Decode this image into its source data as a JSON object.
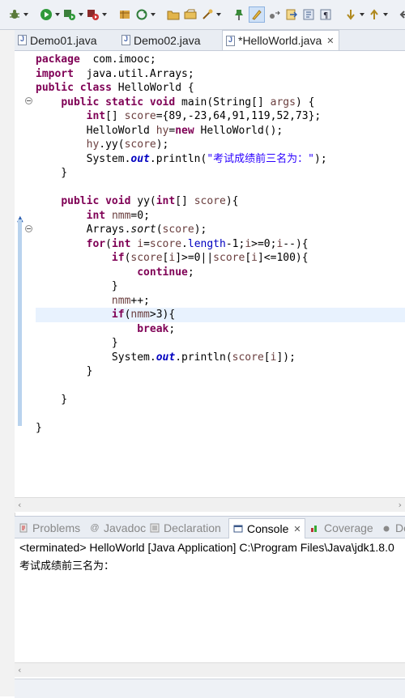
{
  "toolbar": {
    "icons": [
      "debug-icon",
      "run-icon",
      "run-config-icon",
      "external-tools-icon",
      "new-java-project-icon",
      "refresh-icon",
      "open-folder-icon",
      "open-task-icon",
      "open-resource-icon",
      "pin-icon",
      "highlight-icon",
      "forward-icon",
      "toggle-comment-icon",
      "show-whitespace-icon",
      "next-annotation-icon",
      "previous-annotation-icon"
    ]
  },
  "editor": {
    "tabs": [
      {
        "label": "Demo01.java",
        "active": false
      },
      {
        "label": "Demo02.java",
        "active": false
      },
      {
        "label": "*HelloWorld.java",
        "active": true
      }
    ],
    "close_glyph": "✕"
  },
  "code_lines": [
    [
      [
        "kw",
        "package"
      ],
      [
        "",
        "  com.imooc;"
      ]
    ],
    [
      [
        "kw",
        "import"
      ],
      [
        "",
        "  java.util.Arrays;"
      ]
    ],
    [
      [
        "kw",
        "public"
      ],
      [
        "",
        " "
      ],
      [
        "kw",
        "class"
      ],
      [
        "",
        " HelloWorld {"
      ]
    ],
    [
      [
        "",
        "    "
      ],
      [
        "kw",
        "public"
      ],
      [
        "",
        " "
      ],
      [
        "kw",
        "static"
      ],
      [
        "",
        " "
      ],
      [
        "kw",
        "void"
      ],
      [
        "",
        " main(String[] "
      ],
      [
        "var",
        "args"
      ],
      [
        "",
        ") {"
      ]
    ],
    [
      [
        "",
        "        "
      ],
      [
        "kw",
        "int"
      ],
      [
        "",
        "[] "
      ],
      [
        "var",
        "score"
      ],
      [
        "",
        "={89,-23,64,91,119,52,73};"
      ]
    ],
    [
      [
        "",
        "        HelloWorld "
      ],
      [
        "var",
        "hy"
      ],
      [
        "",
        "="
      ],
      [
        "kw",
        "new"
      ],
      [
        "",
        " HelloWorld();"
      ]
    ],
    [
      [
        "",
        "        "
      ],
      [
        "var",
        "hy"
      ],
      [
        "",
        ".yy("
      ],
      [
        "var",
        "score"
      ],
      [
        "",
        ");"
      ]
    ],
    [
      [
        "",
        "        System."
      ],
      [
        "fld",
        "out"
      ],
      [
        "",
        ".println("
      ],
      [
        "str",
        "\"考试成绩前三名为：\""
      ],
      [
        "",
        ");"
      ]
    ],
    [
      [
        "",
        "    }"
      ]
    ],
    [
      [
        "",
        ""
      ]
    ],
    [
      [
        "",
        "    "
      ],
      [
        "kw",
        "public"
      ],
      [
        "",
        " "
      ],
      [
        "kw",
        "void"
      ],
      [
        "",
        " yy("
      ],
      [
        "kw",
        "int"
      ],
      [
        "",
        "[] "
      ],
      [
        "var",
        "score"
      ],
      [
        "",
        "){"
      ]
    ],
    [
      [
        "",
        "        "
      ],
      [
        "kw",
        "int"
      ],
      [
        "",
        " "
      ],
      [
        "var",
        "nmm"
      ],
      [
        "",
        "=0;"
      ]
    ],
    [
      [
        "",
        "        Arrays."
      ],
      [
        "ital",
        "sort"
      ],
      [
        "",
        "("
      ],
      [
        "var",
        "score"
      ],
      [
        "",
        ");"
      ]
    ],
    [
      [
        "",
        "        "
      ],
      [
        "kw",
        "for"
      ],
      [
        "",
        "("
      ],
      [
        "kw",
        "int"
      ],
      [
        "",
        " "
      ],
      [
        "var",
        "i"
      ],
      [
        "",
        "="
      ],
      [
        "var",
        "score"
      ],
      [
        "",
        "."
      ],
      [
        "fldn",
        "length"
      ],
      [
        "",
        "-1;"
      ],
      [
        "var",
        "i"
      ],
      [
        "",
        ">=0;"
      ],
      [
        "var",
        "i"
      ],
      [
        "",
        "--){"
      ]
    ],
    [
      [
        "",
        "            "
      ],
      [
        "kw",
        "if"
      ],
      [
        "",
        "("
      ],
      [
        "var",
        "score"
      ],
      [
        "",
        "["
      ],
      [
        "var",
        "i"
      ],
      [
        "",
        "]>=0||"
      ],
      [
        "var",
        "score"
      ],
      [
        "",
        "["
      ],
      [
        "var",
        "i"
      ],
      [
        "",
        "]<=100){"
      ]
    ],
    [
      [
        "",
        "                "
      ],
      [
        "kw",
        "continue"
      ],
      [
        "",
        ";"
      ]
    ],
    [
      [
        "",
        "            }"
      ]
    ],
    [
      [
        "",
        "            "
      ],
      [
        "var",
        "nmm"
      ],
      [
        "",
        "++;"
      ]
    ],
    [
      [
        "",
        "            "
      ],
      [
        "kw",
        "if"
      ],
      [
        "",
        "("
      ],
      [
        "var",
        "nmm"
      ],
      [
        "",
        ">3){"
      ]
    ],
    [
      [
        "",
        "                "
      ],
      [
        "kw",
        "break"
      ],
      [
        "",
        ";"
      ]
    ],
    [
      [
        "",
        "            }"
      ]
    ],
    [
      [
        "",
        "            System."
      ],
      [
        "fld",
        "out"
      ],
      [
        "",
        ".println("
      ],
      [
        "var",
        "score"
      ],
      [
        "",
        "["
      ],
      [
        "var",
        "i"
      ],
      [
        "",
        "]);"
      ]
    ],
    [
      [
        "",
        "        }"
      ]
    ],
    [
      [
        "",
        ""
      ]
    ],
    [
      [
        "",
        "    }"
      ]
    ],
    [
      [
        "",
        ""
      ]
    ],
    [
      [
        "",
        "}"
      ]
    ]
  ],
  "views": {
    "tabs": [
      {
        "label": "Problems",
        "icon": "problems-icon",
        "active": false
      },
      {
        "label": "Javadoc",
        "icon": "javadoc-icon",
        "active": false
      },
      {
        "label": "Declaration",
        "icon": "declaration-icon",
        "active": false
      },
      {
        "label": "Console",
        "icon": "console-icon",
        "active": true
      },
      {
        "label": "Coverage",
        "icon": "coverage-icon",
        "active": false
      },
      {
        "label": "De",
        "icon": "debug-view-icon",
        "active": false
      }
    ]
  },
  "console": {
    "header": "<terminated> HelloWorld [Java Application] C:\\Program Files\\Java\\jdk1.8.0",
    "output": "考试成绩前三名为："
  },
  "colors": {
    "keyword": "#7f0055",
    "variable": "#6a3e3e",
    "field": "#0000c0",
    "string": "#2a00ff",
    "current_line": "#e8f2fe"
  }
}
